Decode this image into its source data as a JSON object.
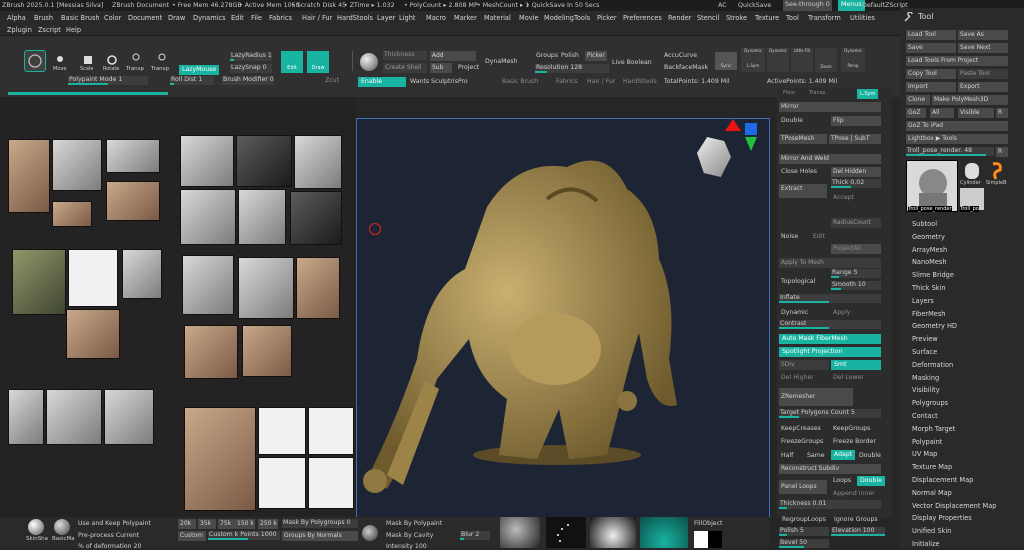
{
  "titlebar": {
    "app": "ZBrush 2025.0.1 [Messias Silva]",
    "doc": "ZBrush Document",
    "freemem": "• Free Mem 46.278GB",
    "activemem": "• Active Mem 1050",
    "scratch": "• Scratch Disk 45",
    "ztime": "• ZTime ▸ 1.032",
    "polycount": "• PolyCount ▸ 2.808 MP",
    "meshcount": "• MeshCount ▸ 1",
    "quicksave_timer": "• QuickSave In 50 Secs",
    "ac": "AC",
    "quicksave": "QuickSave",
    "seethrough": "See-through  0",
    "menus": "Menus",
    "defaultscript": "DefaultZScript"
  },
  "menu_row1": [
    "Alpha",
    "Brush",
    "Basic Brush",
    "Color",
    "Document",
    "Draw",
    "Dynamics",
    "Edit",
    "File",
    "Fabrics",
    "Hair / Fur",
    "HardStools",
    "Layer",
    "Light",
    "Macro",
    "Marker",
    "Material",
    "Movie",
    "ModelingTools",
    "Picker",
    "Preferences",
    "Render",
    "Stencil",
    "Stroke",
    "Texture",
    "Tool",
    "Transform",
    "Utilities"
  ],
  "menu_row2": [
    "Zplugin",
    "Zscript",
    "Help"
  ],
  "shelf": {
    "move": "Move",
    "scale": "Scale",
    "rotate": "Rotate",
    "transp1": "Transp",
    "transp2": "Transp",
    "lazymouse": "LazyMouse",
    "lazyradius": "LazyRadius 1",
    "lazysnap": "LazySnap 0",
    "polypaint_mode": "Polypaint Mode 1",
    "roll_dist": "Roll Dist 1",
    "brush_modifier": "Brush Modifier 0",
    "zcut": "Zcut",
    "edit": "Edit",
    "draw": "Draw",
    "thickness": "Thickness",
    "add": "Add",
    "create_shell": "Create Shell",
    "sub": "Sub",
    "project": "Project",
    "dynamesh": "DynaMesh",
    "groups": "Groups",
    "polish": "Polish",
    "picker": "Picker",
    "live_boolean": "Live Boolean",
    "resolution": "Resolution 128",
    "accucurve": "AccuCurve",
    "backfacemask": "BackfaceMask",
    "sync": "Sync",
    "dynamic": "Dynamic",
    "lsym": "L.Sym",
    "dynamic2": "Dynamic",
    "littlefill": "Little Fill",
    "zoom": "Zoom",
    "dynamic3": "Dynamic",
    "persp": "Persp",
    "enable": "Enable",
    "wants_sculptris": "Wants SculptrisPro",
    "basic_brush": "Basic Brush",
    "fabrics": "Fabrics",
    "hair_fur": "Hair / Fur",
    "hardstools": "HardStools",
    "totalpoints": "TotalPoints: 1.409 Mil",
    "activepoints": "ActivePoints: 1.409 Mil"
  },
  "ptool": {
    "tabs": [
      "Floor",
      "Transp",
      "L.Sym"
    ],
    "mirror": "Mirror",
    "double": "Double",
    "flip": "Flip",
    "tposemesh": "TPoseMesh",
    "tpose_subt": "TPose | SubT",
    "mirror_weld": "Mirror And Weld",
    "close_holes": "Close Holes",
    "del_hidden": "Del Hidden",
    "extract": "Extract",
    "thick": "Thick 0.02",
    "accept": "Accept",
    "radiuscount": "RadiusCount",
    "noise": "Noise",
    "edit": "Edit",
    "projectall": "ProjectAll",
    "apply_to_mesh": "Apply To Mesh",
    "topological": "Topological",
    "range": "Range 5",
    "smooth": "Smooth 10",
    "inflate": "Inflate",
    "dynamic": "Dynamic",
    "apply": "Apply",
    "contrast": "Contrast",
    "auto_mask": "Auto Mask FiberMesh",
    "spotlight": "Spotlight Projection",
    "sdiv": "SDiv",
    "smt": "Smt",
    "del_higher": "Del Higher",
    "del_lower": "Del Lower",
    "zremesher": "ZRemesher",
    "target_polygons": "Target Polygons Count 5",
    "keepcreases": "KeepCreases",
    "keepgroups": "KeepGroups",
    "freezegroups": "FreezeGroups",
    "freeze_border": "Freeze Border",
    "half": "Half",
    "same": "Same",
    "adapt": "Adapt",
    "double2": "Double",
    "reconstruct": "Reconstruct Subdiv",
    "panel_loops": "Panel Loops",
    "loops": "Loops",
    "double3": "Double",
    "append_inner": "Append  Inner",
    "thickness": "Thickness 0.01",
    "regrouploops": "RegroupLoops",
    "ignore_groups": "Ignore Groups",
    "polish": "Polish 5",
    "elevation": "Elevation 100",
    "bevel": "Bevel 50"
  },
  "rtool": {
    "header": "Tool",
    "load_tool": "Load Tool",
    "save_as": "Save As",
    "save": "Save",
    "save_next": "Save Next",
    "load_tools_from_project": "Load Tools From Project",
    "copy_tool": "Copy Tool",
    "paste_tool": "Paste Tool",
    "import": "Import",
    "export": "Export",
    "clone": "Clone",
    "make_polymesh": "Make PolyMesh3D",
    "goz": "GoZ",
    "all": "All",
    "visible": "Visible",
    "r": "R",
    "goz_ipad": "GoZ To iPad",
    "lightbox": "Lightbox ▶ Tools",
    "current": "Troll_pose_render.  48",
    "thumb_troll": "Troll_pose_render",
    "thumb_cylinder": "Cylinder",
    "thumb_simple": "SimpleB",
    "thumb_troll2": "Troll_po",
    "subpalettes": [
      "Subtool",
      "Geometry",
      "ArrayMesh",
      "NanoMesh",
      "Slime Bridge",
      "Thick Skin",
      "Layers",
      "FiberMesh",
      "Geometry HD",
      "Preview",
      "Surface",
      "Deformation",
      "Masking",
      "Visibility",
      "Polygroups",
      "Contact",
      "Morph Target",
      "Polypaint",
      "UV Map",
      "Texture Map",
      "Displacement Map",
      "Normal Map",
      "Vector Displacement Map",
      "Display Properties",
      "Unified Skin",
      "Initialize"
    ]
  },
  "bottom": {
    "skinshade": "SkinSha",
    "basicmat": "BasicMa",
    "use_keep_polypaint": "Use and Keep Polypaint",
    "preprocess": "Pre-process Current",
    "percent_of_deformation": "% of deformation  20",
    "k20": "20k",
    "k35": "35k",
    "k75": "75k",
    "k150": "150 k",
    "k250": "250 k",
    "custom": "Custom",
    "custom_k_points": "Custom k Points 1000",
    "mask_by_polygroups": "Mask By Polygroups 0",
    "groups_by_normals": "Groups By Normals",
    "mask_by_polypaint": "Mask By Polypaint",
    "mask_by_cavity": "Mask By Cavity",
    "blur": "Blur 2",
    "intensity": "Intensity 100",
    "fillobject": "FillObject"
  },
  "colors": {
    "accent": "#19b3a2",
    "canvas_bg": "#1d2535",
    "panel_bg": "#2c2c2c",
    "model": "#a78f55",
    "orange": "#ff8c1a"
  }
}
